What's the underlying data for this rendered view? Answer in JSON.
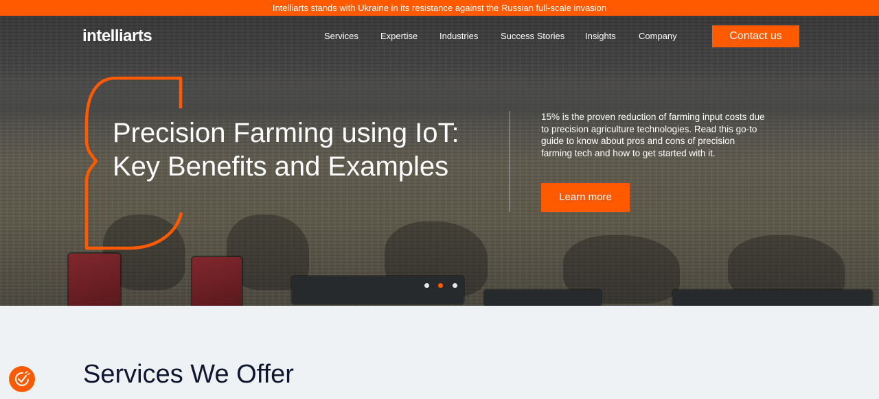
{
  "banner": {
    "text": "Intelliarts stands with Ukraine in its resistance against the Russian full-scale invasion"
  },
  "header": {
    "logo": "intelliarts",
    "nav": [
      {
        "label": "Services"
      },
      {
        "label": "Expertise"
      },
      {
        "label": "Industries"
      },
      {
        "label": "Success Stories"
      },
      {
        "label": "Insights"
      },
      {
        "label": "Company"
      }
    ],
    "contact_label": "Contact us"
  },
  "hero": {
    "title": "Precision Farming using IoT: Key Benefits and Examples",
    "description": "15% is the proven reduction of farming input costs due to precision agriculture technologies. Read this go-to guide to know about pros and cons of precision farming tech and how to get started with it.",
    "cta_label": "Learn more",
    "slides_total": 3,
    "active_slide": 2
  },
  "services": {
    "title": "Services We Offer"
  },
  "floating_widget": {
    "icon": "check-badge-icon"
  },
  "colors": {
    "accent": "#ff5a00",
    "dark_text": "#0f1730",
    "section_bg": "#eef2f5"
  }
}
